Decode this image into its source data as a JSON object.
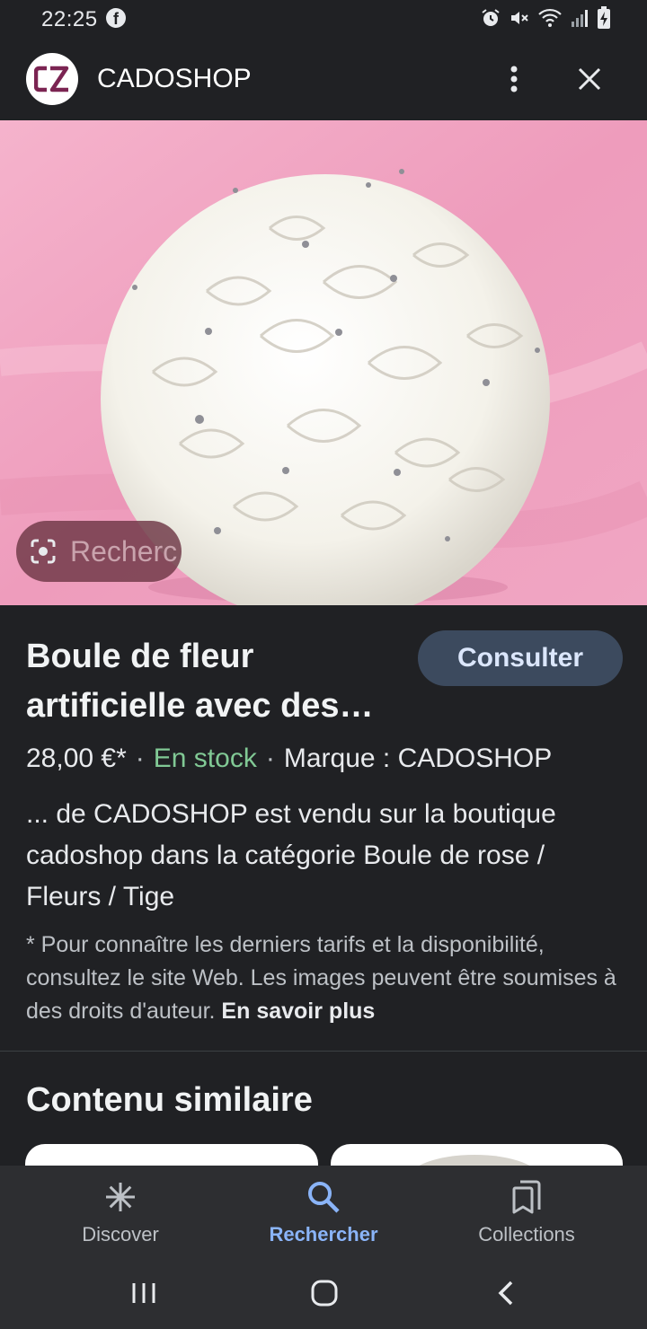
{
  "status_bar": {
    "time": "22:25",
    "icons": [
      "facebook-icon",
      "alarm-icon",
      "mute-icon",
      "wifi-icon",
      "signal-icon",
      "battery-charging-icon"
    ]
  },
  "header": {
    "site_name": "CADOSHOP",
    "logo_text": "CS",
    "more_icon": "more-vert-icon",
    "close_icon": "close-icon"
  },
  "image": {
    "lens_label": "Recherc",
    "colors": {
      "background": "#f0a0bf",
      "flower": "#f7f5ef"
    }
  },
  "product": {
    "title": "Boule de fleur artificielle avec des…",
    "action_label": "Consulter",
    "price": "28,00 €*",
    "stock": "En stock",
    "brand": "Marque : CADOSHOP",
    "description": "... de CADOSHOP est vendu sur la boutique cadoshop dans la catégorie Boule de rose / Fleurs / Tige",
    "disclaimer": "* Pour connaître les derniers tarifs et la disponibilité, consultez le site Web. Les images peuvent être soumises à des droits d'auteur.",
    "learn_more": "En savoir plus"
  },
  "similar": {
    "heading": "Contenu similaire"
  },
  "bottom_nav": {
    "items": [
      {
        "label": "Discover",
        "icon": "asterisk-icon",
        "active": false
      },
      {
        "label": "Rechercher",
        "icon": "search-icon",
        "active": true
      },
      {
        "label": "Collections",
        "icon": "bookmarks-icon",
        "active": false
      }
    ]
  },
  "colors": {
    "background": "#202124",
    "accent": "#8ab4f8",
    "in_stock": "#81c995",
    "button": "#3c4a5e"
  }
}
